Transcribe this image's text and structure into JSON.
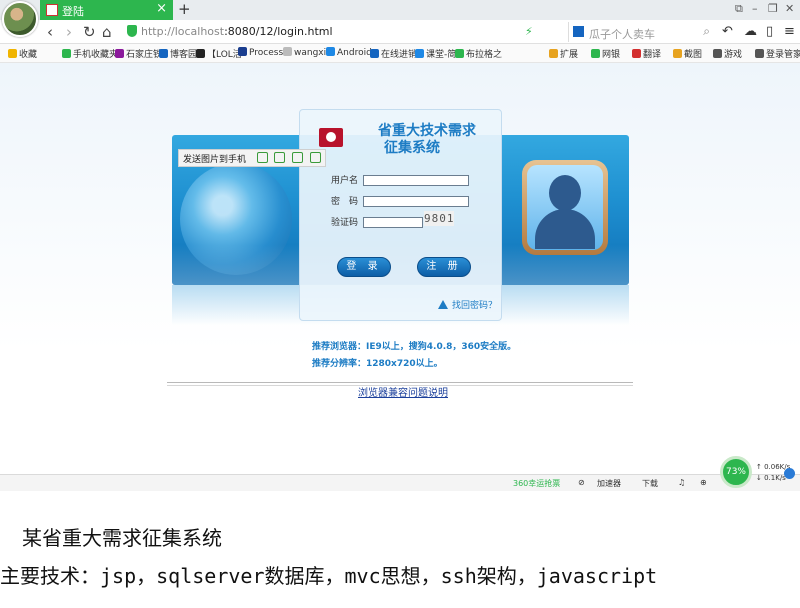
{
  "browser": {
    "tab_title": "登陆",
    "tab_close": "×",
    "new_tab": "+",
    "url_host": "http://localhost",
    "url_path": ":8080/12/login.html",
    "search_placeholder": "瓜子个人卖车",
    "nav": {
      "back": "‹",
      "forward": "›",
      "reload": "↻",
      "home": "⌂"
    },
    "window_controls": {
      "restore": "⧉",
      "minimize": "–",
      "maximize": "❐",
      "close": "✕"
    },
    "right_tools": {
      "undo": "↶",
      "cloud": "☁",
      "phone": "▯",
      "menu": "≡"
    }
  },
  "bookmarks": {
    "left": [
      {
        "label": "收藏",
        "color": "#f0b400"
      },
      {
        "label": "手机收藏夹",
        "color": "#2db64e"
      },
      {
        "label": "石家庄铁",
        "color": "#8b1a9c"
      },
      {
        "label": "博客园",
        "color": "#1565c0"
      },
      {
        "label": "【LOL活",
        "color": "#222222"
      },
      {
        "label": "Process",
        "color": "#1a3d8f"
      },
      {
        "label": "wangxia",
        "color": "#999999"
      },
      {
        "label": "Android",
        "color": "#1e88e5"
      },
      {
        "label": "在线进销",
        "color": "#1565c0"
      },
      {
        "label": "课堂-简",
        "color": "#1e88e5"
      },
      {
        "label": "布拉格之",
        "color": "#2db64e"
      }
    ],
    "right": [
      {
        "label": "扩展",
        "color": "#e7a320"
      },
      {
        "label": "网银",
        "color": "#2db64e"
      },
      {
        "label": "翻译",
        "color": "#d32f2f"
      },
      {
        "label": "截图",
        "color": "#e7a320"
      },
      {
        "label": "游戏",
        "color": "#555555"
      },
      {
        "label": "登录管家",
        "color": "#555555"
      }
    ]
  },
  "float_toolbar": {
    "send_label": "发送图片到手机"
  },
  "login": {
    "title_line1": "省重大技术需求",
    "title_line2": "征集系统",
    "username_label": "用户名",
    "password_label": "密　码",
    "captcha_label": "验证码",
    "captcha_text": "9801",
    "login_button": "登 录",
    "register_button": "注 册",
    "forgot_link": "找回密码？"
  },
  "recommend": {
    "browser": "推荐浏览器：IE9以上，搜狗4.0.8，360安全版。",
    "resolution": "推荐分辨率：1280x720以上。"
  },
  "compat_link": "浏览器兼容问题说明",
  "statusbar": {
    "item_360": "360幸运抢票",
    "accelerator": "加速器",
    "download": "下载",
    "speed_percent": "73%",
    "upload_speed": "0.06K/s",
    "download_speed": "0.1K/s"
  },
  "caption": {
    "line1": "某省重大需求征集系统",
    "line2": "主要技术：jsp，sqlserver数据库，mvc思想，ssh架构，javascript"
  },
  "colors": {
    "tab_green": "#2db64e",
    "banner_blue": "#1e8fd0",
    "title_blue": "#1d7cc4",
    "logo_red": "#b8122b"
  }
}
